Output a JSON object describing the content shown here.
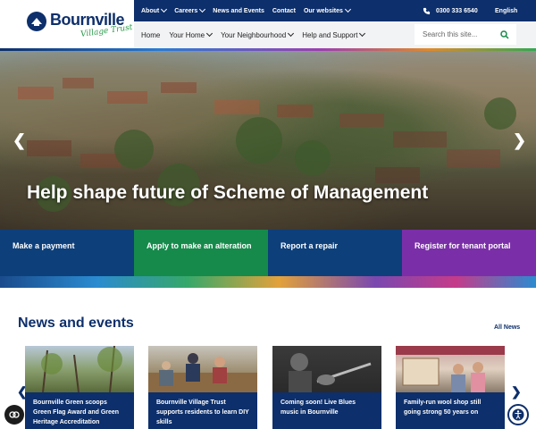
{
  "brand": {
    "name": "Bournville",
    "tagline": "Village Trust"
  },
  "topnav": {
    "items": [
      "About",
      "Careers",
      "News and Events",
      "Contact",
      "Our websites"
    ],
    "phone": "0300 333 6540",
    "language": "English"
  },
  "mainnav": {
    "items": [
      "Home",
      "Your Home",
      "Your Neighbourhood",
      "Help and Support"
    ],
    "search_placeholder": "Search this site..."
  },
  "hero": {
    "title": "Help shape future of Scheme of Management",
    "prev_glyph": "❮",
    "next_glyph": "❯"
  },
  "tiles": [
    {
      "label": "Make a payment",
      "color": "#0d3f7a"
    },
    {
      "label": "Apply to make an alteration",
      "color": "#158a4a"
    },
    {
      "label": "Report a repair",
      "color": "#0d3f7a"
    },
    {
      "label": "Register for tenant portal",
      "color": "#7a2fa8"
    }
  ],
  "news": {
    "heading": "News and events",
    "all_label": "All News",
    "prev_glyph": "❮",
    "next_glyph": "❯",
    "cards": [
      {
        "title": "Bournville Green scoops Green Flag Award and Green Heritage Accreditation"
      },
      {
        "title": "Bournville Village Trust supports residents to learn DIY skills"
      },
      {
        "title": "Coming soon! Live Blues music in Bournville"
      },
      {
        "title": "Family-run wool shop still going strong 50 years on"
      }
    ]
  },
  "colors": {
    "navy": "#0d2f6b",
    "green": "#158a4a",
    "purple": "#7a2fa8",
    "accent_green": "#2a9a4a"
  },
  "icons": {
    "phone": "phone-icon",
    "search": "search-icon",
    "chat": "cookie-chat-icon",
    "accessibility": "accessibility-icon"
  }
}
